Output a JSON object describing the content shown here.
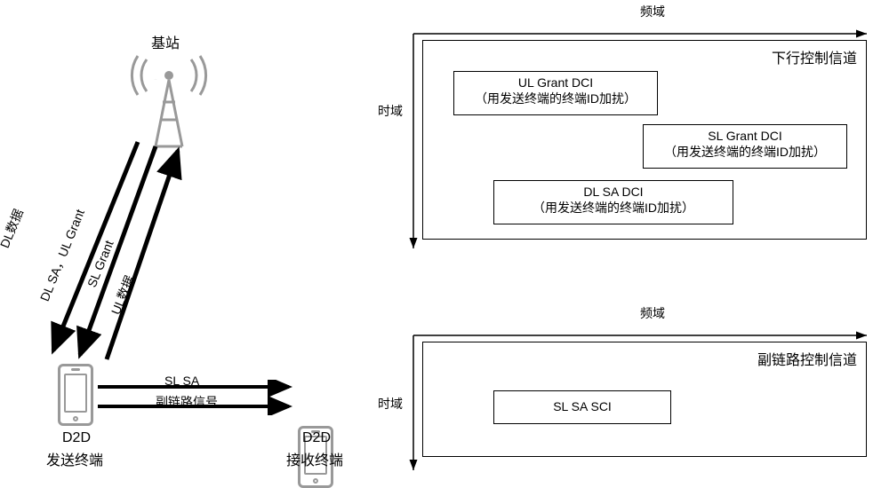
{
  "left": {
    "bs_label": "基站",
    "tx_name": "D2D",
    "tx_sub": "发送终端",
    "rx_name": "D2D",
    "rx_sub": "接收终端",
    "arrows": {
      "dl_data": "DL数据",
      "dl_sa_ul_grant": "DL SA，UL Grant",
      "sl_grant": "SL Grant",
      "ul_data": "UL数据",
      "sl_sa": "SL SA",
      "sl_signal": "副链路信号"
    }
  },
  "top_chart": {
    "freq_axis": "频域",
    "time_axis": "时域",
    "title": "下行控制信道",
    "boxes": {
      "ul_grant": {
        "line1": "UL Grant DCI",
        "line2": "（用发送终端的终端ID加扰）"
      },
      "sl_grant": {
        "line1": "SL Grant DCI",
        "line2": "（用发送终端的终端ID加扰）"
      },
      "dl_sa": {
        "line1": "DL SA DCI",
        "line2": "（用发送终端的终端ID加扰）"
      }
    }
  },
  "bottom_chart": {
    "freq_axis": "频域",
    "time_axis": "时域",
    "title": "副链路控制信道",
    "boxes": {
      "sl_sa_sci": {
        "line1": "SL SA SCI"
      }
    }
  },
  "chart_data": [
    {
      "type": "diagram",
      "title": "下行控制信道",
      "x_axis": "频域",
      "y_axis": "时域",
      "items": [
        {
          "name": "UL Grant DCI",
          "note": "用发送终端的终端ID加扰",
          "freq_pos": "low",
          "time_pos": "early"
        },
        {
          "name": "SL Grant DCI",
          "note": "用发送终端的终端ID加扰",
          "freq_pos": "high",
          "time_pos": "mid"
        },
        {
          "name": "DL SA DCI",
          "note": "用发送终端的终端ID加扰",
          "freq_pos": "mid",
          "time_pos": "late"
        }
      ]
    },
    {
      "type": "diagram",
      "title": "副链路控制信道",
      "x_axis": "频域",
      "y_axis": "时域",
      "items": [
        {
          "name": "SL SA SCI",
          "freq_pos": "low",
          "time_pos": "early"
        }
      ]
    }
  ]
}
